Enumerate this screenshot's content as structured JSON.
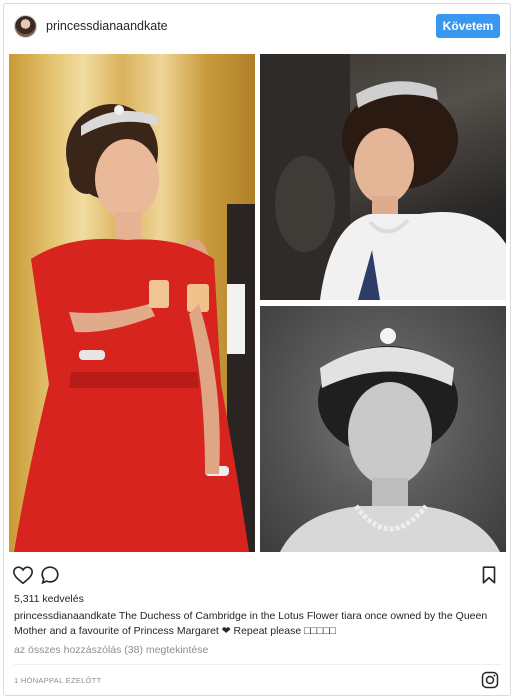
{
  "header": {
    "username": "princessdianaandkate",
    "follow_label": "Követem"
  },
  "post": {
    "likes": "5,311 kedvelés",
    "caption_user": "princessdianaandkate",
    "caption_text": "The Duchess of Cambridge in the Lotus Flower tiara once owned by the Queen Mother and a favourite of Princess Margaret ❤ Repeat please □□□□□",
    "view_comments": "az összes hozzászólás (38) megtekintése",
    "timestamp": "1 HÓNAPPAL EZELŐTT"
  },
  "colors": {
    "follow_button": "#3897f0",
    "border": "#dbdbdb",
    "muted_text": "#8e8e8e"
  },
  "icons": [
    "heart-icon",
    "comment-icon",
    "bookmark-icon",
    "instagram-logo-icon"
  ]
}
